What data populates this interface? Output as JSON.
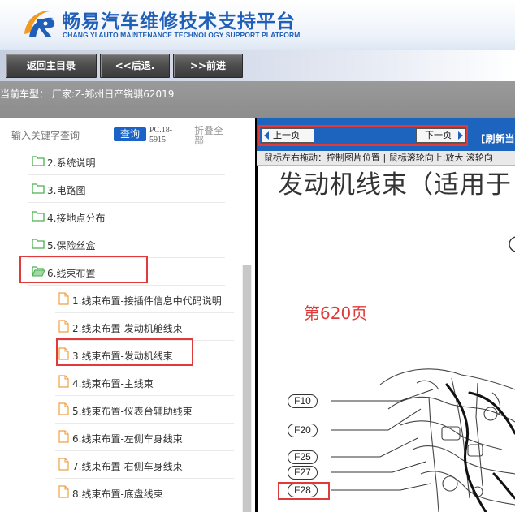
{
  "header": {
    "title_cn": "畅易汽车维修技术支持平台",
    "title_en": "CHANG YI AUTO MAINTENANCE TECHNOLOGY SUPPORT PLATFORM",
    "logo_icon": "r-swoosh-logo-icon"
  },
  "toolbar": {
    "home_label": "返回主目录",
    "back_label": "<<后退.",
    "forward_label": ">>前进"
  },
  "car_info": {
    "text": "当前车型：  厂家:Z-郑州日产锐骐62019"
  },
  "sidebar": {
    "search_placeholder": "输入关键字查询",
    "search_button": "查询",
    "pc_code": "PC.18-5915",
    "collapse_label": "折叠全部",
    "folders": [
      {
        "label": "2.系统说明",
        "icon": "folder-icon",
        "open": false
      },
      {
        "label": "3.电路图",
        "icon": "folder-icon",
        "open": false
      },
      {
        "label": "4.接地点分布",
        "icon": "folder-icon",
        "open": false
      },
      {
        "label": "5.保险丝盒",
        "icon": "folder-icon",
        "open": false
      },
      {
        "label": "6.线束布置",
        "icon": "folder-open-icon",
        "open": true
      }
    ],
    "files": [
      {
        "label": "1.线束布置-接插件信息中代码说明",
        "icon": "file-icon"
      },
      {
        "label": "2.线束布置-发动机舱线束",
        "icon": "file-icon"
      },
      {
        "label": "3.线束布置-发动机线束",
        "icon": "file-icon"
      },
      {
        "label": "4.线束布置-主线束",
        "icon": "file-icon"
      },
      {
        "label": "5.线束布置-仪表台辅助线束",
        "icon": "file-icon"
      },
      {
        "label": "6.线束布置-左侧车身线束",
        "icon": "file-icon"
      },
      {
        "label": "7.线束布置-右侧车身线束",
        "icon": "file-icon"
      },
      {
        "label": "8.线束布置-底盘线束",
        "icon": "file-icon"
      }
    ]
  },
  "viewer": {
    "prev_page": "上一页",
    "next_page": "下一页",
    "refresh_label": "[刷新当",
    "hint": "鼠标左右拖动：控制图片位置 | 鼠标滚轮向上:放大  滚轮向",
    "doc_title": "发动机线束（适用于",
    "page_number": "第620页",
    "connectors": [
      "F10",
      "F20",
      "F25",
      "F27",
      "F28"
    ]
  },
  "colors": {
    "brand_blue": "#1f5fb8",
    "nav_blue": "#1d64bf",
    "highlight_red": "#e03a3a",
    "folder_green": "#4caf50",
    "file_orange": "#f0a040"
  }
}
